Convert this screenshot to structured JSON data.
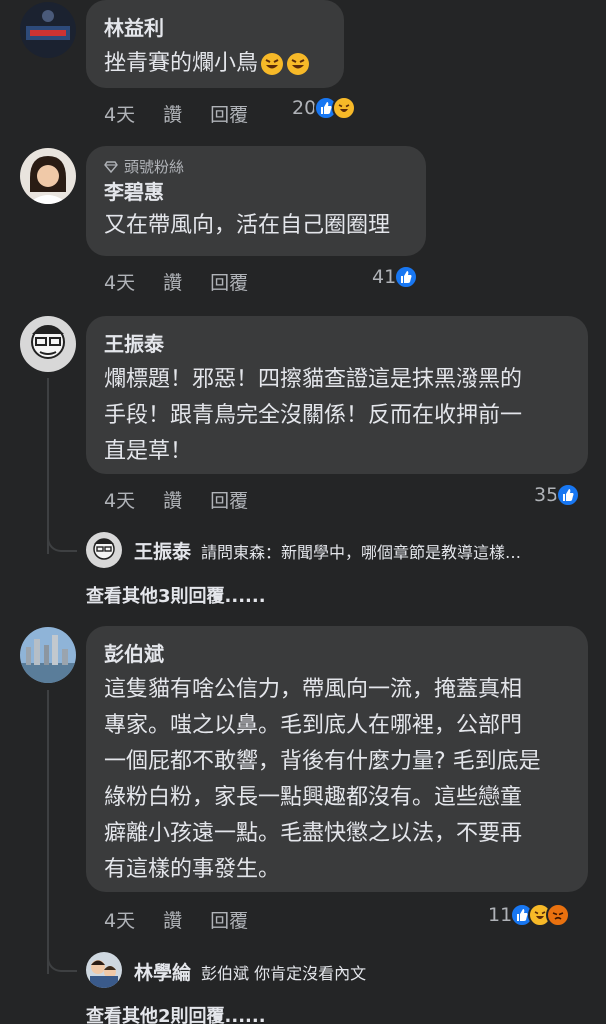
{
  "comments": [
    {
      "author": "林益利",
      "text": "挫青賽的爛小鳥",
      "time": "4天",
      "like_label": "讚",
      "reply_label": "回覆",
      "reaction_count": "20",
      "reactions": [
        "like-icon",
        "haha-icon"
      ]
    },
    {
      "badge": "頭號粉絲",
      "author": "李碧惠",
      "text": "又在帶風向，活在自己圈圈理",
      "time": "4天",
      "like_label": "讚",
      "reply_label": "回覆",
      "reaction_count": "41",
      "reactions": [
        "like-icon"
      ]
    },
    {
      "author": "王振泰",
      "text_lines": [
        "爛標題！邪惡！四擦貓查證這是抹黑潑黑的",
        "手段！跟青鳥完全沒關係！反而在收押前一",
        "直是草！"
      ],
      "time": "4天",
      "like_label": "讚",
      "reply_label": "回覆",
      "reaction_count": "35",
      "reactions": [
        "like-icon"
      ],
      "reply": {
        "author": "王振泰",
        "text": "請問東森：新聞學中，哪個章節是教導這樣…"
      },
      "more_replies": "查看其他3則回覆......"
    },
    {
      "author": "彭伯斌",
      "text_lines": [
        "這隻貓有啥公信力，帶風向一流，掩蓋真相",
        "專家。嗤之以鼻。毛到底人在哪裡，公部門",
        "一個屁都不敢響，背後有什麼力量? 毛到底是",
        "綠粉白粉，家長一點興趣都沒有。這些戀童",
        "癖離小孩遠一點。毛盡快懲之以法，不要再",
        "有這樣的事發生。"
      ],
      "time": "4天",
      "like_label": "讚",
      "reply_label": "回覆",
      "reaction_count": "11",
      "reactions": [
        "like-icon",
        "haha-icon",
        "angry-icon"
      ],
      "reply": {
        "author": "林學綸",
        "text": "彭伯斌 你肯定沒看內文"
      },
      "more_replies": "查看其他2則回覆......"
    }
  ],
  "colors": {
    "background": "#242526",
    "bubble": "#3a3b3c",
    "like": "#1877f2",
    "haha": "#f7b928",
    "angry": "#e9710f"
  }
}
